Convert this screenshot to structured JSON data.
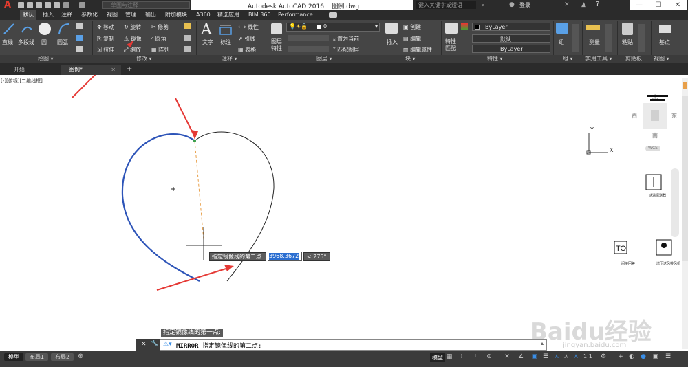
{
  "app_title": "Autodesk AutoCAD 2016",
  "file_name": "图例.dwg",
  "workspace": "草图与注释",
  "search_placeholder": "键入关键字或短语",
  "login": "登录",
  "ribbon_tabs": [
    "默认",
    "插入",
    "注释",
    "参数化",
    "视图",
    "管理",
    "输出",
    "附加模块",
    "A360",
    "精选应用",
    "BIM 360",
    "Performance"
  ],
  "draw": {
    "line": "直线",
    "polyline": "多段线",
    "circle": "圆",
    "arc": "圆弧"
  },
  "modify": {
    "move": "移动",
    "rotate": "旋转",
    "trim": "修剪",
    "copy": "复制",
    "mirror": "镜像",
    "fillet": "圆角",
    "stretch": "拉伸",
    "scale": "缩放",
    "array": "阵列"
  },
  "annotation": {
    "text": "文字",
    "dimension": "标注",
    "linear": "线性",
    "leader": "引线",
    "table": "表格"
  },
  "layers": {
    "properties": "图层\n特性",
    "current_layer": "0",
    "make_current": "置为当前",
    "match_layer": "匹配图层"
  },
  "block": {
    "insert": "插入",
    "create": "创建",
    "edit": "编辑",
    "edit_attributes": "编辑属性"
  },
  "properties": {
    "match": "特性\n匹配",
    "color": "ByLayer",
    "linetype": "默认",
    "lineweight": "ByLayer"
  },
  "groups": {
    "group": "组"
  },
  "utilities": {
    "measure": "测量"
  },
  "clipboard": {
    "paste": "粘贴"
  },
  "view": {
    "base": "基点"
  },
  "panel_titles": [
    "绘图",
    "修改",
    "注释",
    "图层",
    "块",
    "特性",
    "组",
    "实用工具",
    "剪贴板",
    "视图"
  ],
  "doc_tabs": [
    "开始",
    "图例*"
  ],
  "viewport_label": "[-][俯视][二维线框]",
  "viewcube": {
    "north": "北",
    "south": "南",
    "east": "东",
    "west": "西",
    "top": "上",
    "wcs": "WCS"
  },
  "ucs": {
    "x": "X",
    "y": "Y"
  },
  "symbols": [
    "感温探测器",
    "间接回差",
    "增压送风排风机"
  ],
  "tooltip_prompt": "指定镜像线的第二点:",
  "input_value": "3968.3672",
  "angle_value": "< 275°",
  "cmd_history": "指定镜像线的第一点:",
  "cmd_name": "MIRROR",
  "cmd_prompt": "指定镜像线的第二点:",
  "layout_tabs": [
    "模型",
    "布局1",
    "布局2"
  ],
  "status_model": "模型",
  "status_scale": "1:1",
  "watermark": "Baidu经验",
  "watermark_url": "jingyan.baidu.com"
}
